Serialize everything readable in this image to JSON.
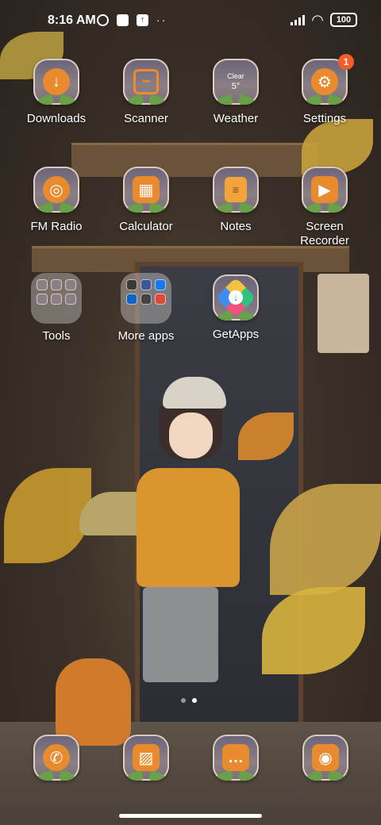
{
  "status_bar": {
    "time": "8:16 AM",
    "notification_icons": [
      "moon-icon",
      "square-icon",
      "upload-icon"
    ],
    "more": "··",
    "battery": "100"
  },
  "apps": {
    "downloads": {
      "label": "Downloads",
      "icon": "download-icon"
    },
    "scanner": {
      "label": "Scanner",
      "icon": "scan-icon"
    },
    "weather": {
      "label": "Weather",
      "condition": "Clear",
      "temp": "5°"
    },
    "settings": {
      "label": "Settings",
      "icon": "gear-icon",
      "badge": "1"
    },
    "fm_radio": {
      "label": "FM Radio",
      "icon": "radio-icon"
    },
    "calculator": {
      "label": "Calculator",
      "icon": "calculator-icon"
    },
    "notes": {
      "label": "Notes",
      "icon": "notes-icon"
    },
    "screen_recorder": {
      "label": "Screen\nRecorder",
      "icon": "video-icon"
    },
    "tools": {
      "label": "Tools"
    },
    "more_apps": {
      "label": "More apps"
    },
    "getapps": {
      "label": "GetApps",
      "icon": "getapps-icon"
    }
  },
  "dock": [
    "phone-icon",
    "gallery-icon",
    "messages-icon",
    "camera-icon"
  ],
  "page_indicator": {
    "pages": 2,
    "active": 1
  },
  "colors": {
    "accent": "#e98a2e",
    "badge": "#f45d2a"
  }
}
